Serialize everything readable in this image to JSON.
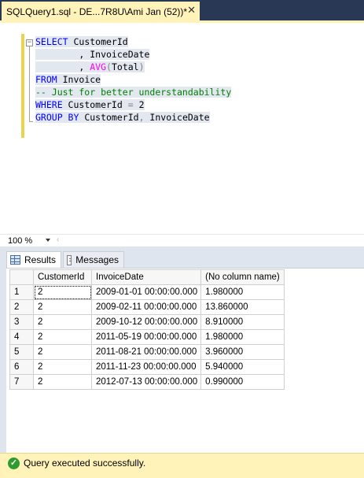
{
  "document_tab": {
    "title": "SQLQuery1.sql - DE...7R8U\\Ami Jan (52))*",
    "close_glyph": "✕"
  },
  "editor": {
    "lines": [
      [
        {
          "t": "SELECT",
          "c": "kw"
        },
        {
          "t": " CustomerId",
          "c": ""
        }
      ],
      [
        {
          "t": "        , InvoiceDate",
          "c": ""
        }
      ],
      [
        {
          "t": "        , ",
          "c": ""
        },
        {
          "t": "AVG",
          "c": "fn"
        },
        {
          "t": "(",
          "c": "gr"
        },
        {
          "t": "Total",
          "c": ""
        },
        {
          "t": ")",
          "c": "gr"
        }
      ],
      [
        {
          "t": "FROM",
          "c": "kw"
        },
        {
          "t": " Invoice",
          "c": ""
        }
      ],
      [
        {
          "t": "-- Just for better understandability",
          "c": "cm"
        }
      ],
      [
        {
          "t": "WHERE",
          "c": "kw"
        },
        {
          "t": " CustomerId ",
          "c": ""
        },
        {
          "t": "=",
          "c": "gr"
        },
        {
          "t": " 2",
          "c": ""
        }
      ],
      [
        {
          "t": "GROUP BY",
          "c": "kw"
        },
        {
          "t": " CustomerId",
          "c": ""
        },
        {
          "t": ",",
          "c": "gr"
        },
        {
          "t": " InvoiceDate",
          "c": ""
        }
      ]
    ]
  },
  "zoom": {
    "value": "100 %"
  },
  "result_tabs": {
    "results_label": "Results",
    "messages_label": "Messages"
  },
  "grid": {
    "columns": [
      "CustomerId",
      "InvoiceDate",
      "(No column name)"
    ],
    "rows": [
      {
        "num": "1",
        "customer": "2",
        "date": "2009-01-01 00:00:00.000",
        "value": "1.980000"
      },
      {
        "num": "2",
        "customer": "2",
        "date": "2009-02-11 00:00:00.000",
        "value": "13.860000"
      },
      {
        "num": "3",
        "customer": "2",
        "date": "2009-10-12 00:00:00.000",
        "value": "8.910000"
      },
      {
        "num": "4",
        "customer": "2",
        "date": "2011-05-19 00:00:00.000",
        "value": "1.980000"
      },
      {
        "num": "5",
        "customer": "2",
        "date": "2011-08-21 00:00:00.000",
        "value": "3.960000"
      },
      {
        "num": "6",
        "customer": "2",
        "date": "2011-11-23 00:00:00.000",
        "value": "5.940000"
      },
      {
        "num": "7",
        "customer": "2",
        "date": "2012-07-13 00:00:00.000",
        "value": "0.990000"
      }
    ]
  },
  "status": {
    "message": "Query executed successfully.",
    "icon": "check-circle-icon",
    "icon_glyph": "✓"
  },
  "colors": {
    "tab_active": "#fff3b9",
    "tab_strip": "#293955",
    "keyword": "#0000ff",
    "function": "#ff00ff",
    "comment": "#008000",
    "status_bar": "#fff3b9"
  }
}
